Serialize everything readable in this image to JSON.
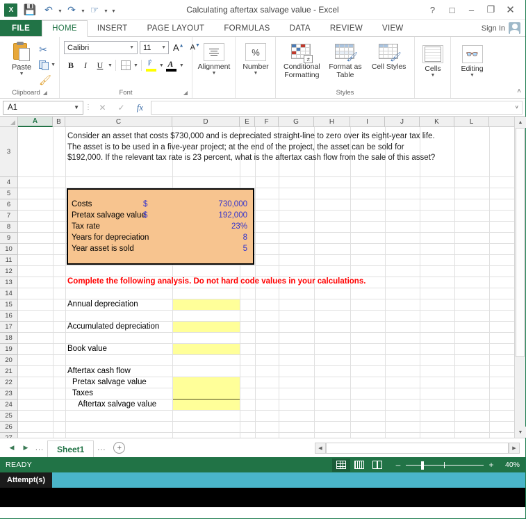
{
  "window": {
    "title": "Calculating aftertax salvage value - Excel",
    "app_logo": "excel-logo",
    "help_label": "?",
    "restore_up_label": "□",
    "minimize_label": "–",
    "maximize_label": "❐",
    "close_label": "✕"
  },
  "quick_access": {
    "save": "save-icon",
    "undo": "undo-icon",
    "redo": "redo-icon",
    "touch": "touch-mode-icon",
    "customize": "customize-qat-icon"
  },
  "tabs": {
    "file": "FILE",
    "items": [
      "HOME",
      "INSERT",
      "PAGE LAYOUT",
      "FORMULAS",
      "DATA",
      "REVIEW",
      "VIEW"
    ],
    "active": "HOME",
    "sign_in": "Sign In"
  },
  "ribbon": {
    "groups": [
      {
        "name": "Clipboard",
        "label": "Clipboard"
      },
      {
        "name": "Font",
        "label": "Font"
      },
      {
        "name": "Alignment",
        "label": "Alignment"
      },
      {
        "name": "Number",
        "label": "Number"
      },
      {
        "name": "Styles",
        "label": "Styles"
      },
      {
        "name": "Cells",
        "label": "Cells"
      },
      {
        "name": "Editing",
        "label": "Editing"
      }
    ],
    "clipboard": {
      "paste": "Paste",
      "cut": "cut-icon",
      "copy": "copy-icon",
      "format_painter": "format-painter-icon"
    },
    "font": {
      "family_value": "Calibri",
      "size_value": "11",
      "grow_font": "A",
      "shrink_font": "A",
      "bold": "B",
      "italic": "I",
      "underline": "U",
      "borders": "borders-icon",
      "fill_color": "fill-color-icon",
      "font_color": "font-color-icon"
    },
    "alignment": {
      "label": "Alignment"
    },
    "number": {
      "label": "Number",
      "percent_glyph": "%"
    },
    "styles": {
      "conditional_formatting": "Conditional Formatting",
      "format_as_table": "Format as Table",
      "cell_styles": "Cell Styles"
    },
    "cells": {
      "label": "Cells"
    },
    "editing": {
      "label": "Editing"
    },
    "collapse": "˄"
  },
  "formula_bar": {
    "name_box_value": "A1",
    "cancel": "✕",
    "enter": "✓",
    "insert_function": "fx",
    "formula_value": "",
    "expand_label": "˅"
  },
  "grid": {
    "columns": [
      "A",
      "B",
      "C",
      "D",
      "E",
      "F",
      "G",
      "H",
      "I",
      "J",
      "K",
      "L"
    ],
    "selected_column": "A",
    "rows": [
      "3",
      "4",
      "5",
      "6",
      "7",
      "8",
      "9",
      "10",
      "11",
      "12",
      "13",
      "14",
      "15",
      "16",
      "17",
      "18",
      "19",
      "20",
      "21",
      "22",
      "23",
      "24",
      "25",
      "26",
      "27"
    ],
    "question_text": "Consider an asset that costs $730,000 and is depreciated straight-line to zero over its eight-year tax life. The asset is to be used in a five-year project; at the end of the project, the asset can be sold for $192,000. If the relevant tax rate is 23 percent, what is the aftertax cash flow from the sale of this asset?",
    "input_box": {
      "rows": [
        {
          "label": "Costs",
          "currency": "$",
          "value": "730,000"
        },
        {
          "label": "Pretax salvage value",
          "currency": "$",
          "value": "192,000"
        },
        {
          "label": "Tax rate",
          "currency": "",
          "value": "23%"
        },
        {
          "label": "Years for depreciation",
          "currency": "",
          "value": "8"
        },
        {
          "label": "Year asset is sold",
          "currency": "",
          "value": "5"
        }
      ],
      "fill_color": "#f7c48f",
      "border_color": "#000000",
      "value_color": "#3333cc"
    },
    "instruction": "Complete the following analysis. Do not hard code values in your calculations.",
    "instruction_color": "#ff0000",
    "analysis_rows": [
      {
        "label": "Annual depreciation",
        "row": "15",
        "input": true,
        "indent": 0
      },
      {
        "label": "Accumulated depreciation",
        "row": "17",
        "input": true,
        "indent": 0
      },
      {
        "label": "Book value",
        "row": "19",
        "input": true,
        "indent": 0
      },
      {
        "label": "Aftertax cash flow",
        "row": "21",
        "input": false,
        "indent": 0
      },
      {
        "label": "Pretax salvage value",
        "row": "22",
        "input": true,
        "indent": 1
      },
      {
        "label": "Taxes",
        "row": "23",
        "input": true,
        "indent": 1
      },
      {
        "label": "Aftertax salvage value",
        "row": "24",
        "input": true,
        "indent": 2
      }
    ],
    "input_cell_color": "#ffff99"
  },
  "sheet_bar": {
    "first_label": "◀",
    "prev_label": "▶",
    "left_dots": "...",
    "sheets": [
      "Sheet1"
    ],
    "active_sheet": "Sheet1",
    "right_dots": "...",
    "add_sheet": "+"
  },
  "status_bar": {
    "status": "READY",
    "view_normal": "normal-view-icon",
    "view_page_layout": "page-layout-view-icon",
    "view_page_break": "page-break-view-icon",
    "zoom_out": "–",
    "zoom_in": "+",
    "zoom_level": "40%"
  },
  "footer": {
    "attempts_label": "Attempt(s)"
  }
}
